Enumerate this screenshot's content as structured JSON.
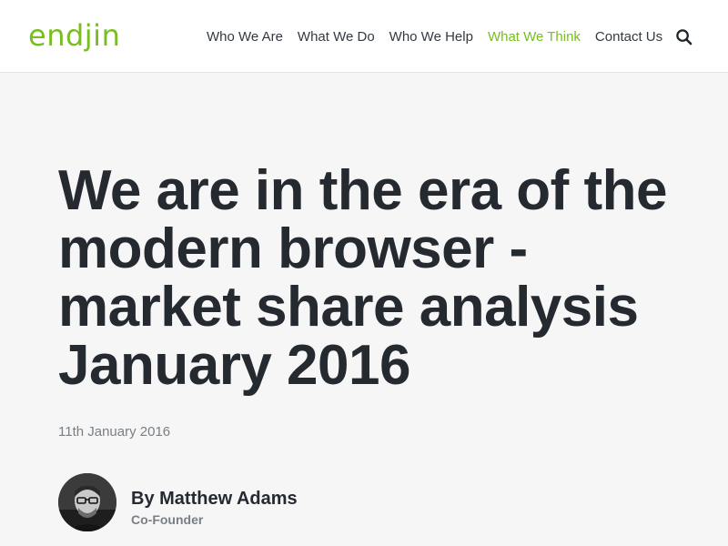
{
  "brand": {
    "logo_text": "endjin",
    "accent_color": "#78be20"
  },
  "nav": {
    "items": [
      {
        "label": "Who We Are",
        "active": false
      },
      {
        "label": "What We Do",
        "active": false
      },
      {
        "label": "Who We Help",
        "active": false
      },
      {
        "label": "What We Think",
        "active": true
      },
      {
        "label": "Contact Us",
        "active": false
      }
    ],
    "search_icon": "search-icon"
  },
  "article": {
    "title": "We are in the era of the modern browser - market share analysis January 2016",
    "date": "11th January 2016",
    "author": {
      "name": "By Matthew Adams",
      "role": "Co-Founder",
      "avatar_icon": "avatar"
    }
  }
}
